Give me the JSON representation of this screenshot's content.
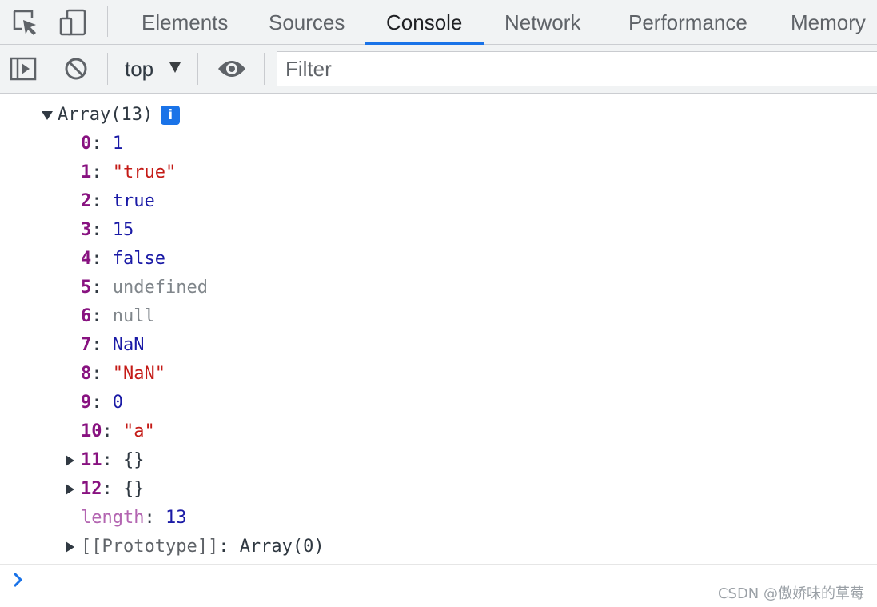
{
  "tabs": [
    {
      "label": "Elements",
      "active": false
    },
    {
      "label": "Sources",
      "active": false
    },
    {
      "label": "Console",
      "active": true
    },
    {
      "label": "Network",
      "active": false
    },
    {
      "label": "Performance",
      "active": false
    },
    {
      "label": "Memory",
      "active": false
    }
  ],
  "toolbar": {
    "context": "top",
    "filter_placeholder": "Filter"
  },
  "icons": {
    "inspect": "inspect-element-icon",
    "device": "device-toggle-icon",
    "sidebar": "show-sidebar-icon",
    "clear": "clear-console-icon",
    "eye": "live-expression-icon",
    "prompt": "chevron-right-icon",
    "info": "info-icon"
  },
  "console": {
    "array_label": "Array(13)",
    "info_glyph": "i",
    "items": [
      {
        "key": "0",
        "value": "1",
        "type": "num"
      },
      {
        "key": "1",
        "value": "\"true\"",
        "type": "str"
      },
      {
        "key": "2",
        "value": "true",
        "type": "num"
      },
      {
        "key": "3",
        "value": "15",
        "type": "num"
      },
      {
        "key": "4",
        "value": "false",
        "type": "num"
      },
      {
        "key": "5",
        "value": "undefined",
        "type": "dim"
      },
      {
        "key": "6",
        "value": "null",
        "type": "dim"
      },
      {
        "key": "7",
        "value": "NaN",
        "type": "num"
      },
      {
        "key": "8",
        "value": "\"NaN\"",
        "type": "str"
      },
      {
        "key": "9",
        "value": "0",
        "type": "num"
      },
      {
        "key": "10",
        "value": "\"a\"",
        "type": "str"
      },
      {
        "key": "11",
        "value": "{}",
        "type": "obj"
      },
      {
        "key": "12",
        "value": "{}",
        "type": "obj"
      }
    ],
    "length_key": "length",
    "length_value": "13",
    "prototype_label": "[[Prototype]]",
    "prototype_value": "Array(0)"
  },
  "watermark": "CSDN @傲娇味的草莓",
  "colors": {
    "accent": "#1a73e8",
    "key": "#881280",
    "number": "#1a1aa6",
    "string": "#c41a16",
    "muted": "#80868b"
  }
}
